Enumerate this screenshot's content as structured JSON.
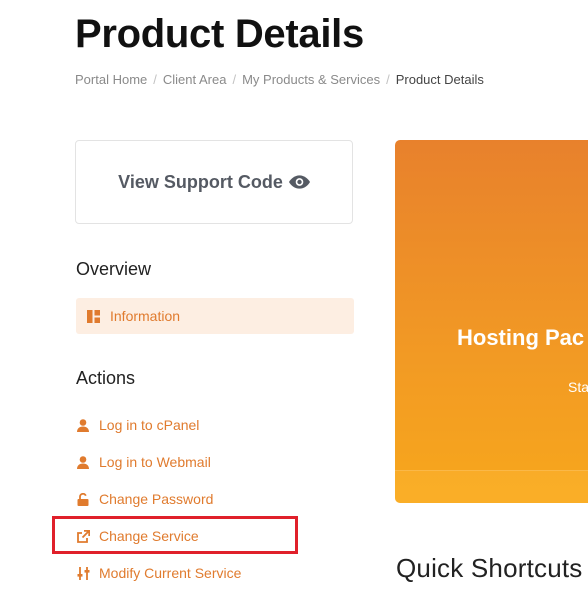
{
  "page": {
    "title": "Product Details"
  },
  "breadcrumb": {
    "items": [
      "Portal Home",
      "Client Area",
      "My Products & Services"
    ],
    "active": "Product Details"
  },
  "support": {
    "label": "View Support Code",
    "icon": "eye-icon"
  },
  "overview": {
    "title": "Overview",
    "items": [
      {
        "label": "Information",
        "icon": "dashboard-icon"
      }
    ]
  },
  "actions": {
    "title": "Actions",
    "items": [
      {
        "label": "Log in to cPanel",
        "icon": "user-icon"
      },
      {
        "label": "Log in to Webmail",
        "icon": "user-icon"
      },
      {
        "label": "Change Password",
        "icon": "unlock-icon"
      },
      {
        "label": "Change Service",
        "icon": "external-link-icon"
      },
      {
        "label": "Modify Current Service",
        "icon": "sliders-icon"
      }
    ]
  },
  "hero": {
    "title": "Hosting Pac",
    "status": "Sta"
  },
  "shortcuts": {
    "title": "Quick Shortcuts"
  },
  "colors": {
    "accent": "#e07b2e",
    "highlight": "#e0202a",
    "hero_start": "#e8812c",
    "hero_end": "#f7a71c"
  }
}
